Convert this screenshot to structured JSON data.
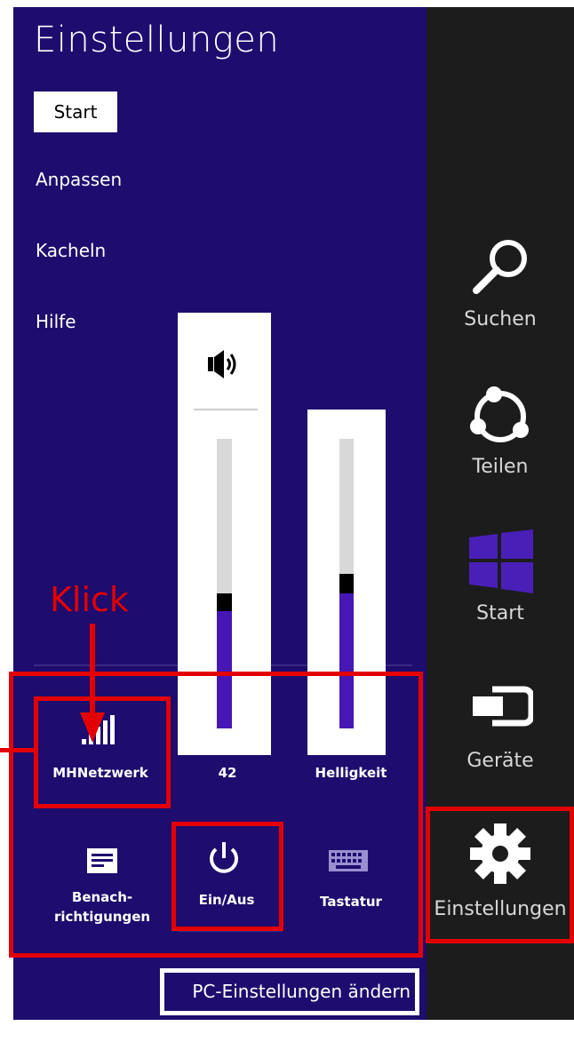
{
  "panel": {
    "title": "Einstellungen",
    "start_label": "Start",
    "nav": [
      "Anpassen",
      "Kacheln",
      "Hilfe"
    ]
  },
  "volume": {
    "level": 42,
    "label": "42",
    "icon": "speaker-icon"
  },
  "brightness": {
    "level_fraction": 0.49,
    "label": "Helligkeit"
  },
  "tiles": {
    "network": {
      "label": "MHNetzwerk",
      "icon": "signal-bars-icon"
    },
    "notifications": {
      "label_line1": "Benach-",
      "label_line2": "richtigungen",
      "icon": "notification-icon"
    },
    "power": {
      "label": "Ein/Aus",
      "icon": "power-icon"
    },
    "keyboard": {
      "label": "Tastatur",
      "icon": "keyboard-icon"
    }
  },
  "pc_settings_label": "PC-Einstellungen ändern",
  "annotation": {
    "text": "Klick"
  },
  "charms": [
    {
      "label": "Suchen",
      "icon": "search-icon"
    },
    {
      "label": "Teilen",
      "icon": "share-icon"
    },
    {
      "label": "Start",
      "icon": "windows-logo-icon"
    },
    {
      "label": "Geräte",
      "icon": "devices-icon"
    },
    {
      "label": "Einstellungen",
      "icon": "gear-icon"
    }
  ],
  "colors": {
    "panel_bg": "#1e0c6e",
    "charms_bg": "#1c1c1c",
    "accent": "#4617b4",
    "highlight_red": "#e30000"
  }
}
